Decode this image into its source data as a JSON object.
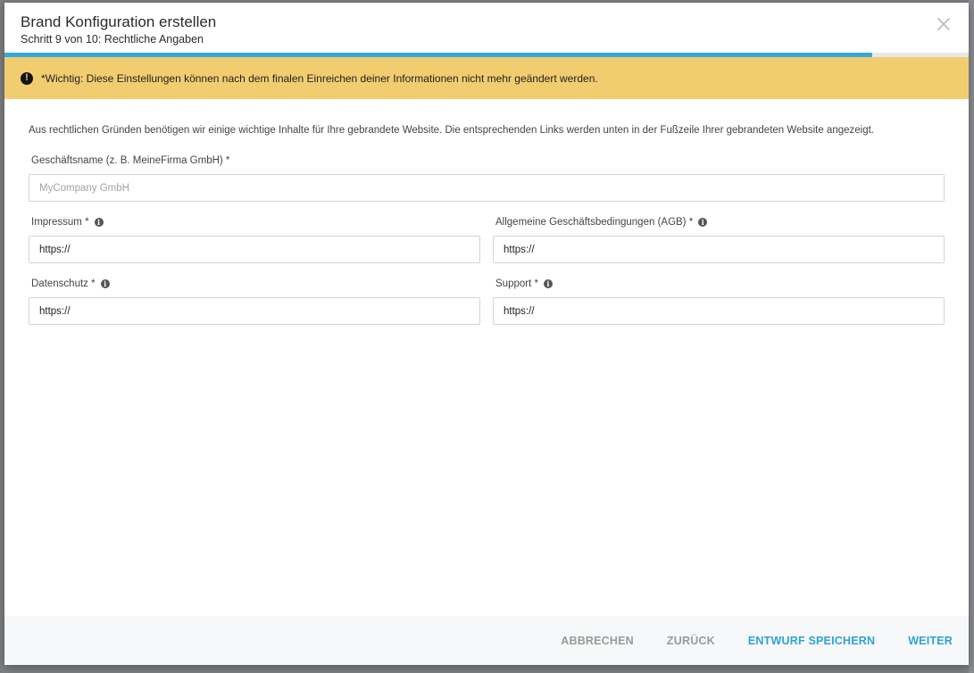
{
  "dialog": {
    "title": "Brand Konfiguration erstellen",
    "subtitle": "Schritt 9 von 10: Rechtliche Angaben",
    "progress_percent": 90,
    "close_icon": "close-icon"
  },
  "warning": {
    "icon": "exclamation-circle-icon",
    "text": "*Wichtig: Diese Einstellungen können nach dem finalen Einreichen deiner Informationen nicht mehr geändert werden."
  },
  "intro": "Aus rechtlichen Gründen benötigen wir einige wichtige Inhalte für Ihre gebrandete Website. Die entsprechenden Links werden unten in der Fußzeile Ihrer gebrandeten Website angezeigt.",
  "fields": {
    "company": {
      "label": "Geschäftsname (z. B. MeineFirma GmbH) *",
      "value": "",
      "placeholder": "MyCompany GmbH"
    },
    "impressum": {
      "label": "Impressum *",
      "value": "https://"
    },
    "agb": {
      "label": "Allgemeine Geschäftsbedingungen (AGB) *",
      "value": "https://"
    },
    "datenschutz": {
      "label": "Datenschutz *",
      "value": "https://"
    },
    "support": {
      "label": "Support *",
      "value": "https://"
    }
  },
  "footer": {
    "cancel": "ABBRECHEN",
    "back": "ZURÜCK",
    "save_draft": "ENTWURF SPEICHERN",
    "next": "WEITER"
  },
  "colors": {
    "accent": "#2ea3d6",
    "warning": "#f2cd70",
    "progress": "#35a9dc"
  }
}
